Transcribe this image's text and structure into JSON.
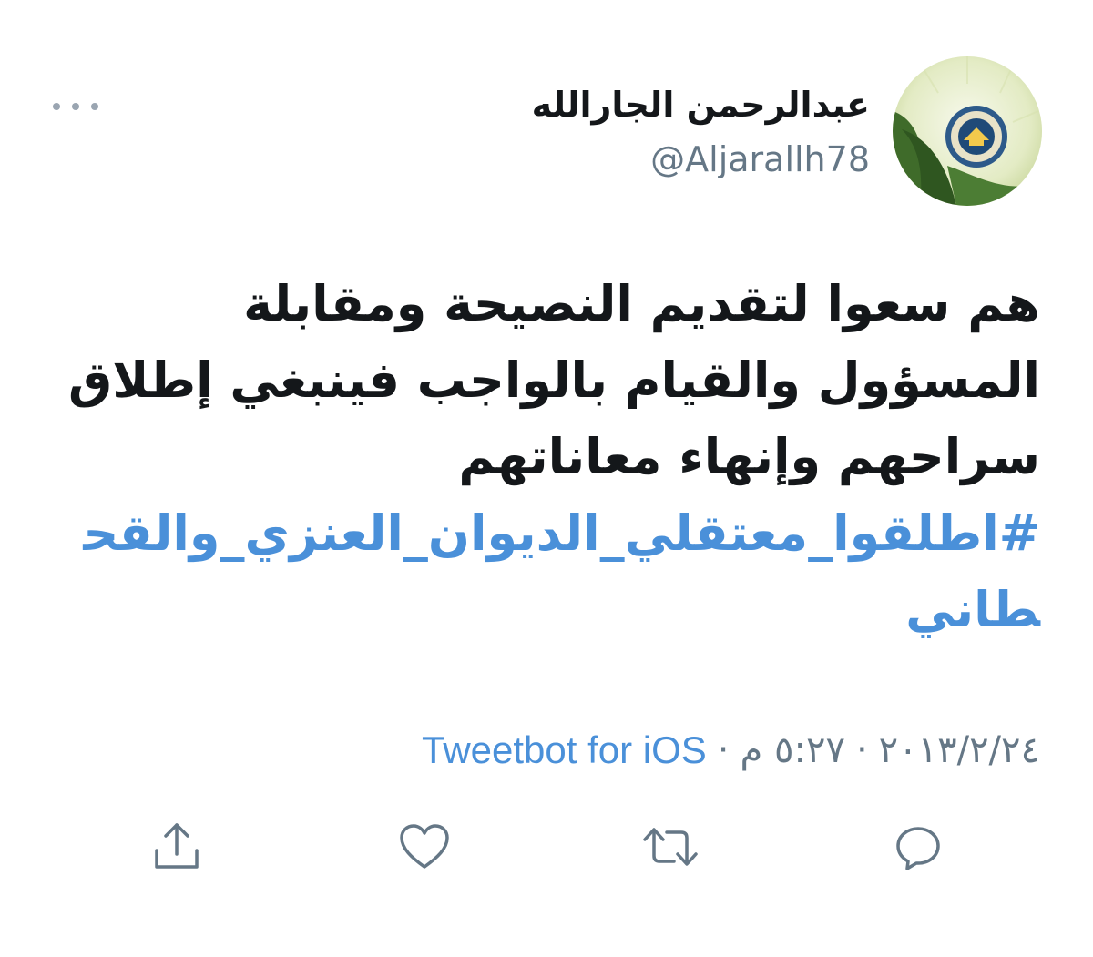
{
  "author": {
    "display_name": "عبدالرحمن الجارالله",
    "handle": "@Aljarallh78"
  },
  "tweet": {
    "lines": [
      "هم سعوا لتقديم النصيحة ومقابلة",
      "المسؤول والقيام بالواجب فينبغي إطلاق",
      "سراحهم وإنهاء معاناتهم"
    ],
    "hashtag": "#اطلقوا_معتقلي_الديوان_العنزي_والقحطاني"
  },
  "meta": {
    "date": "٢٠١٣/٢/٢٤",
    "separator": "·",
    "time": "٥:٢٧ م",
    "source": "Tweetbot for iOS"
  },
  "icons": {
    "more": "more-options-icon",
    "reply": "reply-icon",
    "retweet": "retweet-icon",
    "like": "heart-icon",
    "share": "share-icon"
  },
  "colors": {
    "link": "#4a90d9",
    "secondary": "#657786",
    "icon": "#657786",
    "avatar_green": "#3f6b2a"
  }
}
